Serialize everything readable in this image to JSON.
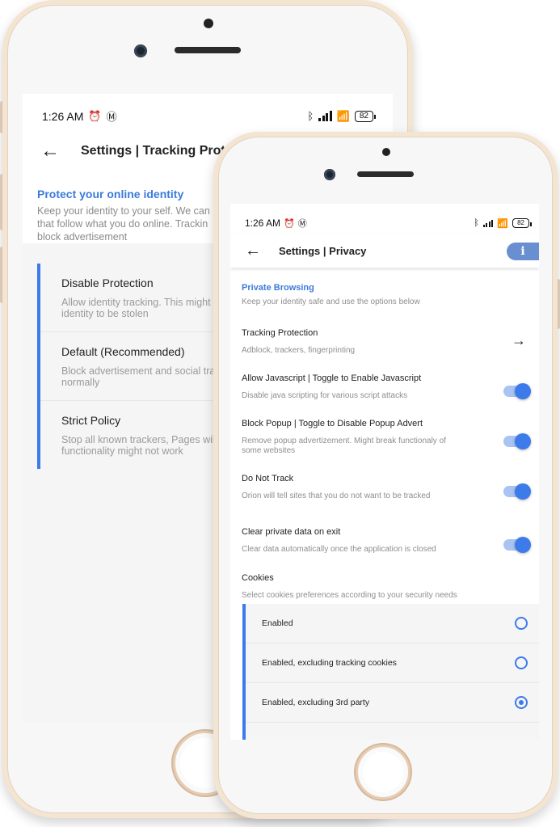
{
  "back_phone": {
    "status": {
      "time": "1:26 AM",
      "battery": "82"
    },
    "header": {
      "title": "Settings | Tracking Protection"
    },
    "section": {
      "title": "Protect your online identity",
      "description_lines": [
        "Keep your identity to your self. We can p",
        "that follow what you do online. Trackin",
        "block advertisement"
      ]
    },
    "options": [
      {
        "title": "Disable Protection",
        "desc_lines": [
          "Allow identity tracking. This might c",
          "identity to be stolen"
        ]
      },
      {
        "title": "Default (Recommended)",
        "desc_lines": [
          "Block advertisement and social tra",
          "normally"
        ]
      },
      {
        "title": "Strict Policy",
        "desc_lines": [
          "Stop all known trackers, Pages will",
          "functionality might not work"
        ]
      }
    ]
  },
  "front_phone": {
    "status": {
      "time": "1:26 AM",
      "battery": "82"
    },
    "header": {
      "title": "Settings | Privacy",
      "info_icon": "info-icon"
    },
    "section": {
      "title": "Private Browsing",
      "description": "Keep your identity safe and use the options below"
    },
    "rows": {
      "tracking": {
        "title": "Tracking Protection",
        "desc": "Adblock, trackers, fingerprinting"
      },
      "javascript": {
        "title": "Allow Javascript | Toggle to Enable Javascript",
        "desc": "Disable java scripting for various script attacks",
        "on": true
      },
      "popup": {
        "title": "Block Popup | Toggle to Disable Popup Advert",
        "desc_line1": "Remove popup advertizement. Might break functionaly of",
        "desc_line2": "some websites",
        "on": true
      },
      "dnt": {
        "title": "Do Not Track",
        "desc": "Orion will tell sites that you do not want to be tracked",
        "on": true
      },
      "clear": {
        "title": "Clear private data on exit",
        "desc": "Clear data automatically once the application is closed",
        "on": true
      },
      "cookies": {
        "title": "Cookies",
        "desc": "Select cookies preferences according to your security needs"
      }
    },
    "cookie_options": [
      {
        "label": "Enabled",
        "selected": false
      },
      {
        "label": "Enabled, excluding tracking cookies",
        "selected": false
      },
      {
        "label": "Enabled, excluding 3rd party",
        "selected": true
      }
    ]
  },
  "colors": {
    "accent": "#3d7bea",
    "frame": "#f4e4d2",
    "link_blue": "#3b7bdb"
  }
}
